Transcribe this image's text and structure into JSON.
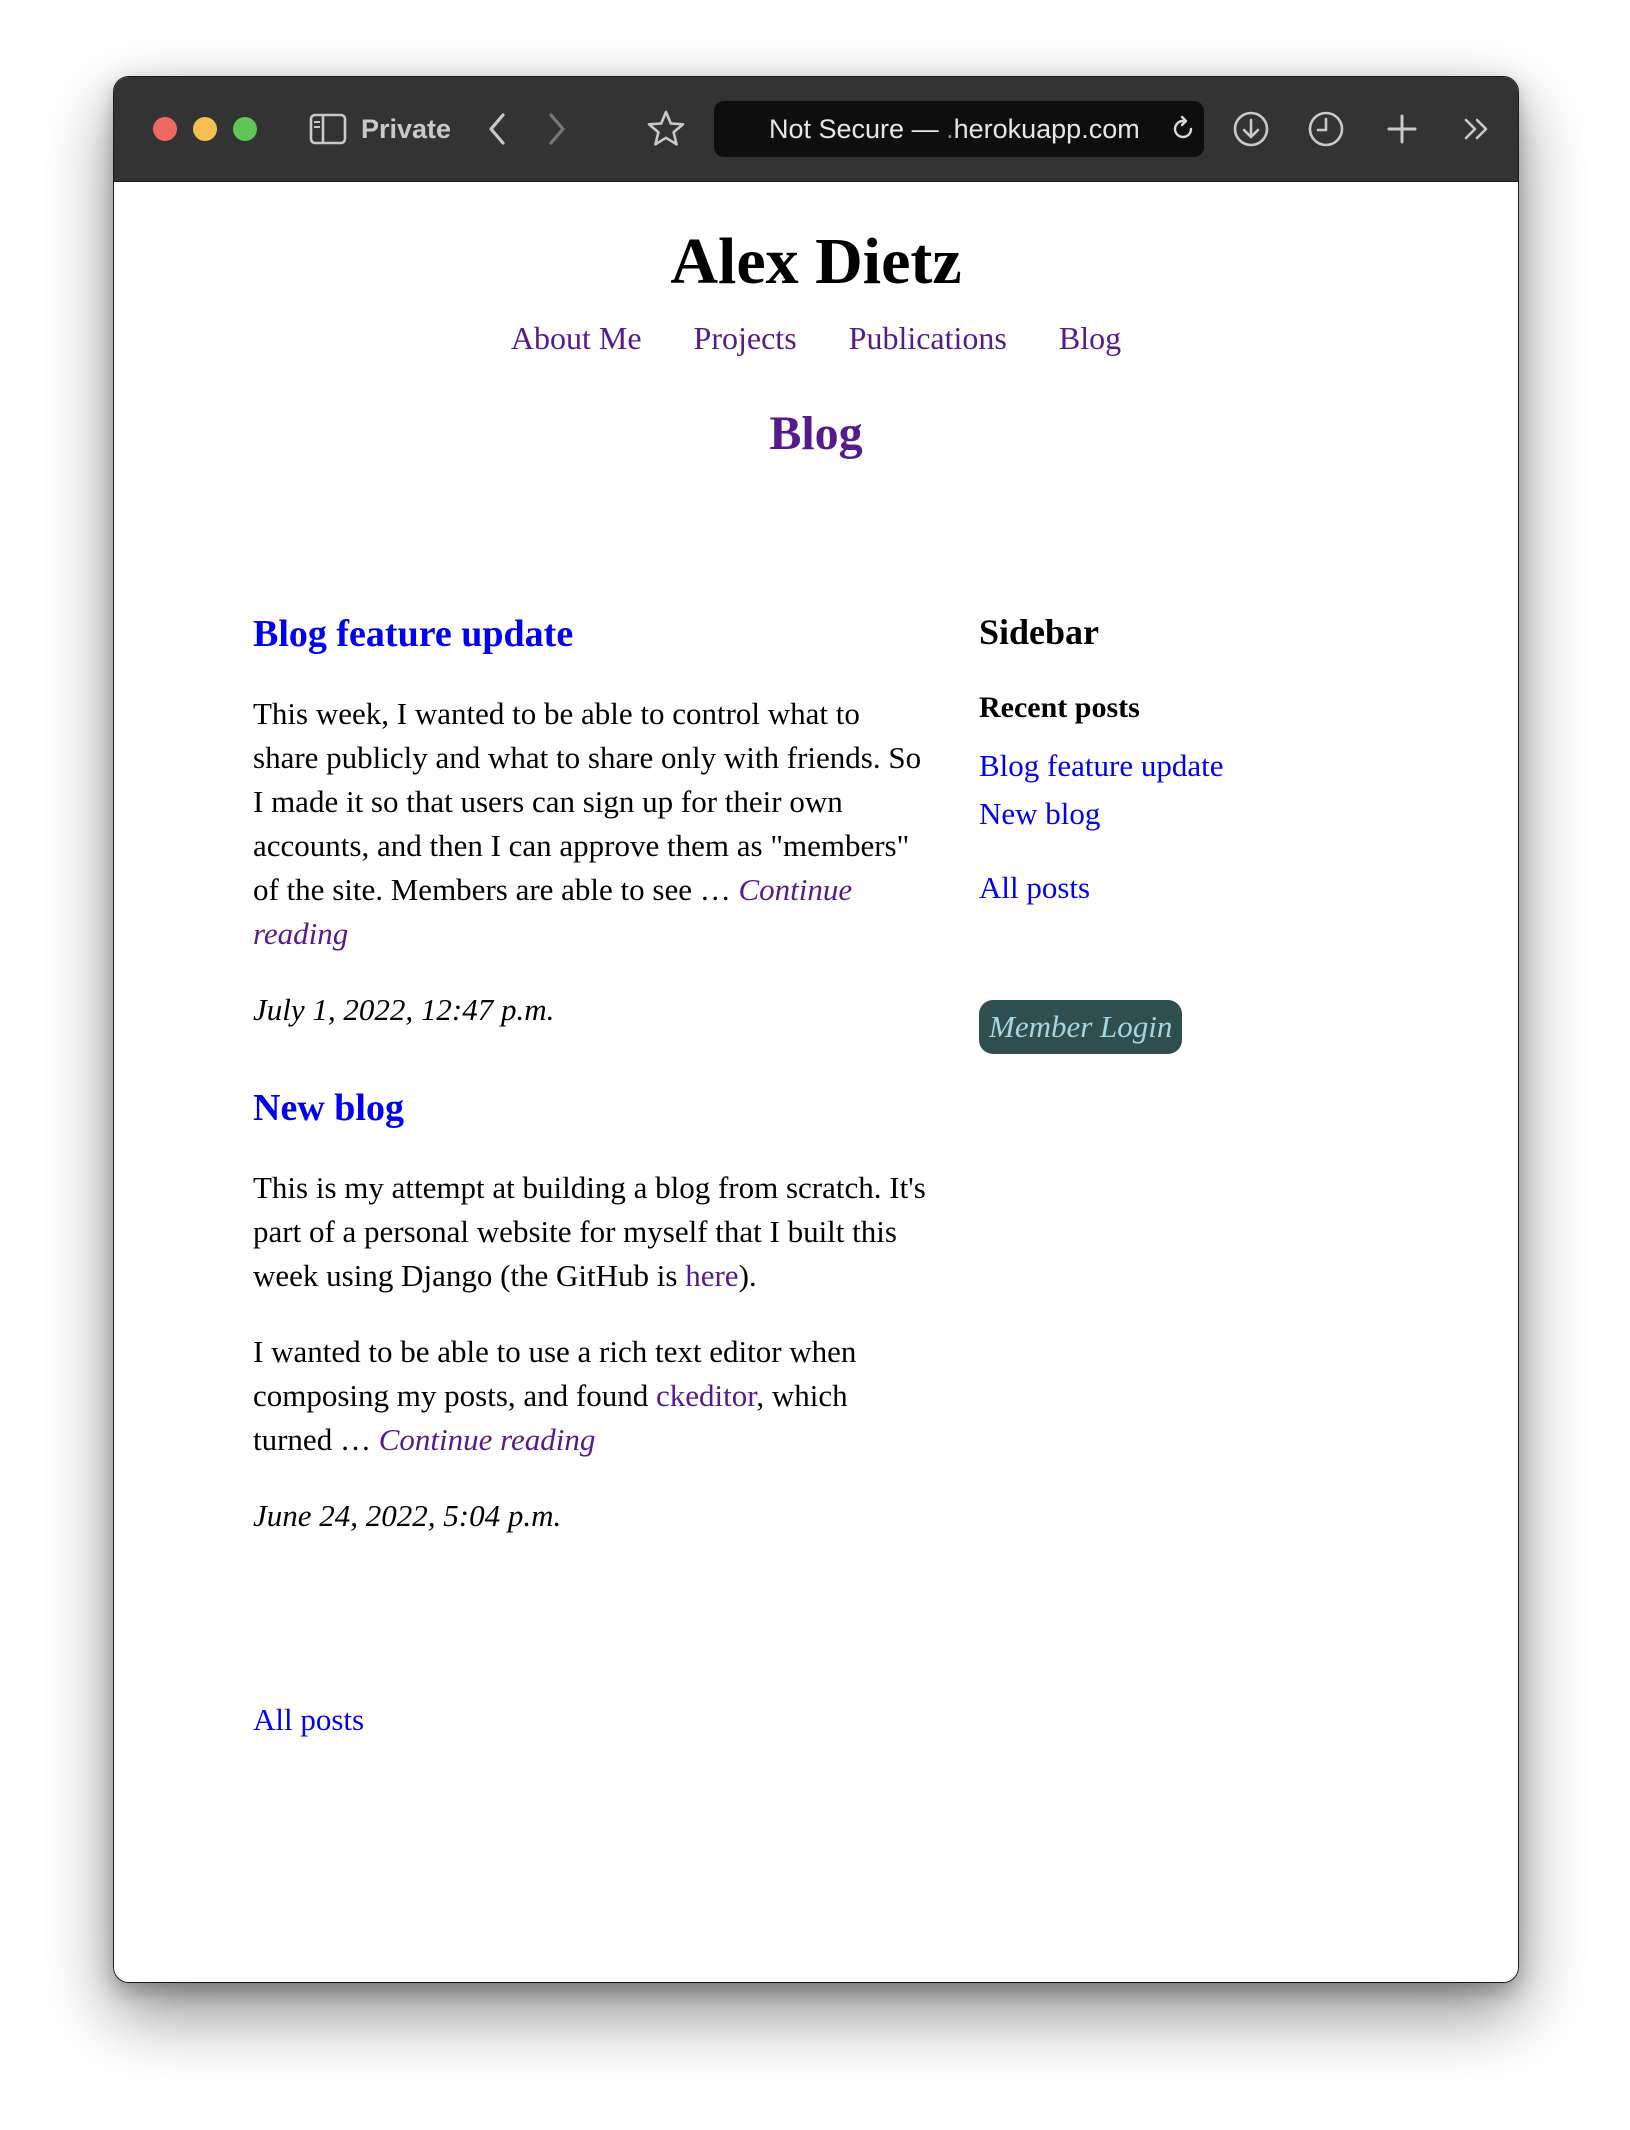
{
  "browser": {
    "private_label": "Private",
    "address_prefix": "Not Secure — ",
    "address_domain_dim": ".",
    "address_domain": "herokuapp.com"
  },
  "site": {
    "title": "Alex Dietz",
    "nav": [
      "About Me",
      "Projects",
      "Publications",
      "Blog"
    ],
    "page_heading": "Blog"
  },
  "posts": [
    {
      "title": "Blog feature update",
      "paragraphs": [
        {
          "text": "This week, I wanted to be able to control what to share publicly and what to share only with friends. So I made it so that users can sign up for their own accounts, and then I can approve them as \"members\" of the site. Members are able to see … "
        }
      ],
      "continue": "Continue reading",
      "date": "July 1, 2022, 12:47 p.m."
    },
    {
      "title": "New blog",
      "p1_before": "This is my attempt at building a blog from scratch. It's part of a personal website for myself that I built this week using Django (the GitHub is ",
      "p1_link": "here",
      "p1_after": ").",
      "p2_before": "I wanted to be able to use a rich text editor when composing my posts, and found ",
      "p2_link": "ckeditor",
      "p2_after": ", which turned … ",
      "continue": "Continue reading",
      "date": "June 24, 2022, 5:04 p.m."
    }
  ],
  "all_posts_label": "All posts",
  "sidebar": {
    "heading": "Sidebar",
    "recent_heading": "Recent posts",
    "recent_posts": [
      "Blog feature update",
      "New blog"
    ],
    "all_posts_label": "All posts",
    "login_label": "Member Login"
  },
  "colors": {
    "toolbar_bg": "#333333",
    "visited_link": "#551a8b",
    "link": "#0000ee",
    "login_bg": "#2f4f4f",
    "login_text": "#a7d6dc"
  }
}
